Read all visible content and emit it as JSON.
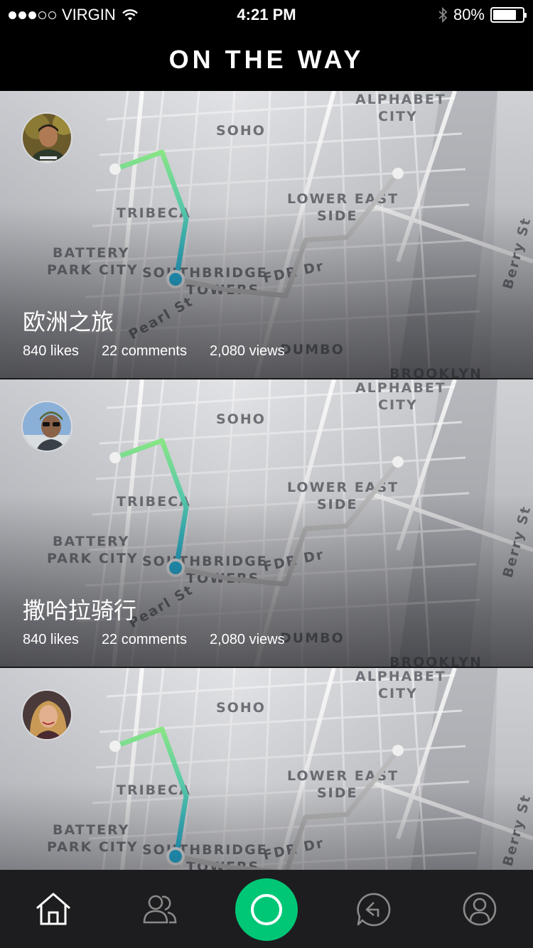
{
  "status_bar": {
    "carrier": "VIRGIN",
    "time": "4:21 PM",
    "battery": "80%",
    "battery_level": 0.8
  },
  "header": {
    "title": "ON THE WAY"
  },
  "map_labels": {
    "alphabet": "ALPHABET",
    "city": "CITY",
    "soho": "SOHO",
    "tribeca": "TRIBECA",
    "battery": "BATTERY",
    "park_city": "PARK CITY",
    "southbridge": "SOUTHBRIDGE",
    "towers": "TOWERS",
    "lower_east": "LOWER EAST",
    "side": "SIDE",
    "fdr": "FDR Dr",
    "pearl": "Pearl St",
    "dumbo": "DUMBO",
    "brooklyn": "BROOKLYN",
    "berry": "Berry St"
  },
  "feed": [
    {
      "title": "欧洲之旅",
      "likes": "840 likes",
      "comments": "22 comments",
      "views": "2,080 views"
    },
    {
      "title": "撒哈拉骑行",
      "likes": "840 likes",
      "comments": "22 comments",
      "views": "2,080 views"
    },
    {
      "title": "",
      "likes": "",
      "comments": "",
      "views": ""
    }
  ],
  "tabbar": {
    "items": [
      "home-icon",
      "friends-icon",
      "record-icon",
      "back-icon",
      "profile-icon"
    ],
    "accent": "#00c776"
  },
  "colors": {
    "route_start": "#8ef08a",
    "route_end": "#1ec0f0",
    "route_gray": "#c8c8c8"
  }
}
